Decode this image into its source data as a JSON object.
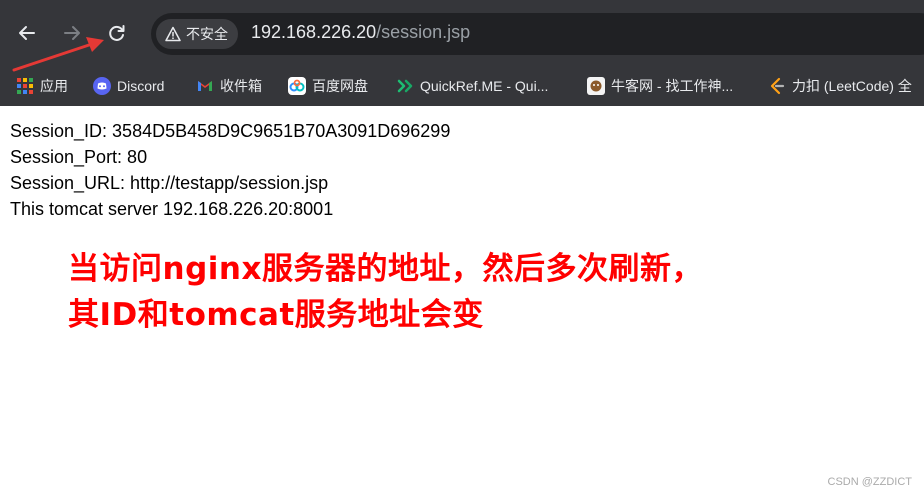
{
  "browser": {
    "security_label": "不安全",
    "url_host": "192.168.226.20",
    "url_path": "/session.jsp"
  },
  "bookmarks": [
    {
      "label": "应用",
      "icon": "apps-grid-icon"
    },
    {
      "label": "Discord",
      "icon": "discord-icon"
    },
    {
      "label": "收件箱",
      "icon": "gmail-icon"
    },
    {
      "label": "百度网盘",
      "icon": "baidu-netdisk-icon"
    },
    {
      "label": "QuickRef.ME - Qui...",
      "icon": "quickref-icon"
    },
    {
      "label": "牛客网 - 找工作神...",
      "icon": "nowcoder-icon"
    },
    {
      "label": "力扣 (LeetCode) 全",
      "icon": "leetcode-icon"
    }
  ],
  "page": {
    "lines": [
      "Session_ID: 3584D5B458D9C9651B70A3091D696299",
      "Session_Port: 80",
      "Session_URL: http://testapp/session.jsp",
      "This tomcat server 192.168.226.20:8001"
    ]
  },
  "annotation": {
    "line1": "当访问nginx服务器的地址，然后多次刷新，",
    "line2": "其ID和tomcat服务地址会变",
    "color": "#ff0000"
  },
  "watermark": "CSDN @ZZDICT",
  "colors": {
    "toolbar_bg": "#35363a",
    "omnibox_bg": "#202124",
    "arrow": "#e53935"
  }
}
